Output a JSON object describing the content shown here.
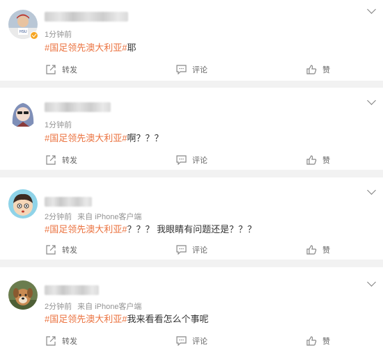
{
  "actions": {
    "repost": "转发",
    "comment": "评论",
    "like": "赞"
  },
  "tag_color": "#eb7340",
  "comments": [
    {
      "time": "1分钟前",
      "source": "",
      "tag": "#国足领先澳大利亚#",
      "text": "耶",
      "verified": true,
      "avatar": "baseball-player-avatar"
    },
    {
      "time": "1分钟前",
      "source": "",
      "tag": "#国足领先澳大利亚#",
      "text": "啊？？？",
      "verified": false,
      "avatar": "anime-girl-avatar"
    },
    {
      "time": "2分钟前",
      "source": "来自 iPhone客户端",
      "tag": "#国足领先澳大利亚#",
      "text": "？？？ 我眼睛有问题还是？？？",
      "verified": false,
      "avatar": "cartoon-boy-avatar"
    },
    {
      "time": "2分钟前",
      "source": "来自 iPhone客户端",
      "tag": "#国足领先澳大利亚#",
      "text": "我来看看怎么个事呢",
      "verified": false,
      "avatar": "dog-avatar"
    }
  ]
}
